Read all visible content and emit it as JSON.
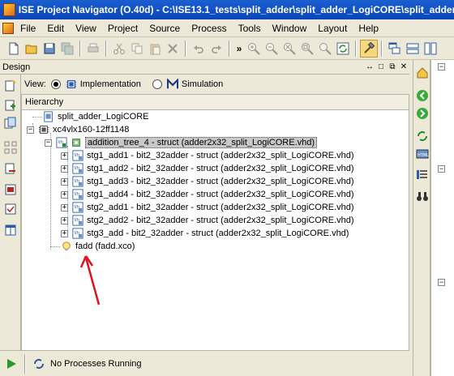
{
  "window": {
    "title": "ISE Project Navigator (O.40d) - C:\\ISE13.1_tests\\split_adder\\split_adder_LogiCORE\\split_adder_LogiCO"
  },
  "menu": {
    "items": [
      "File",
      "Edit",
      "View",
      "Project",
      "Source",
      "Process",
      "Tools",
      "Window",
      "Layout",
      "Help"
    ]
  },
  "toolbar": {
    "icons": [
      "new-file-icon",
      "open-folder-icon",
      "save-icon",
      "save-all-icon",
      "print-icon",
      "cut-icon",
      "copy-icon",
      "paste-icon",
      "delete-icon",
      "undo-icon",
      "redo-icon",
      "more-icon",
      "zoom-in-icon",
      "zoom-out-icon",
      "zoom-fit-icon",
      "zoom-area-icon",
      "zoom-full-icon",
      "refresh-icon",
      "hammer-icon",
      "cascade-icon",
      "tile-icon",
      "tile-vertical-icon"
    ]
  },
  "design_panel": {
    "title": "Design",
    "controls": [
      "↔",
      "□",
      "⧉",
      "✕"
    ],
    "view_label": "View:",
    "view_options": [
      {
        "label": "Implementation",
        "checked": true
      },
      {
        "label": "Simulation",
        "checked": false
      }
    ],
    "hierarchy_header": "Hierarchy"
  },
  "tree": {
    "project": "split_adder_LogiCORE",
    "device": "xc4vlx160-12ff1148",
    "top": "addition_tree_4 - struct (adder2x32_split_LogiCORE.vhd)",
    "children": [
      "stg1_add1 - bit2_32adder - struct (adder2x32_split_LogiCORE.vhd)",
      "stg1_add2 - bit2_32adder - struct (adder2x32_split_LogiCORE.vhd)",
      "stg1_add3 - bit2_32adder - struct (adder2x32_split_LogiCORE.vhd)",
      "stg1_add4 - bit2_32adder - struct (adder2x32_split_LogiCORE.vhd)",
      "stg2_add1 - bit2_32adder - struct (adder2x32_split_LogiCORE.vhd)",
      "stg2_add2 - bit2_32adder - struct (adder2x32_split_LogiCORE.vhd)",
      "stg3_add - bit2_32adder - struct (adder2x32_split_LogiCORE.vhd)"
    ],
    "orphan": "fadd (fadd.xco)"
  },
  "status": {
    "text": "No Processes Running"
  },
  "colors": {
    "titlebar": "#0a46b8",
    "chrome": "#ece9d8",
    "arrow": "#e0141e",
    "selected": "#c8c8c8"
  }
}
